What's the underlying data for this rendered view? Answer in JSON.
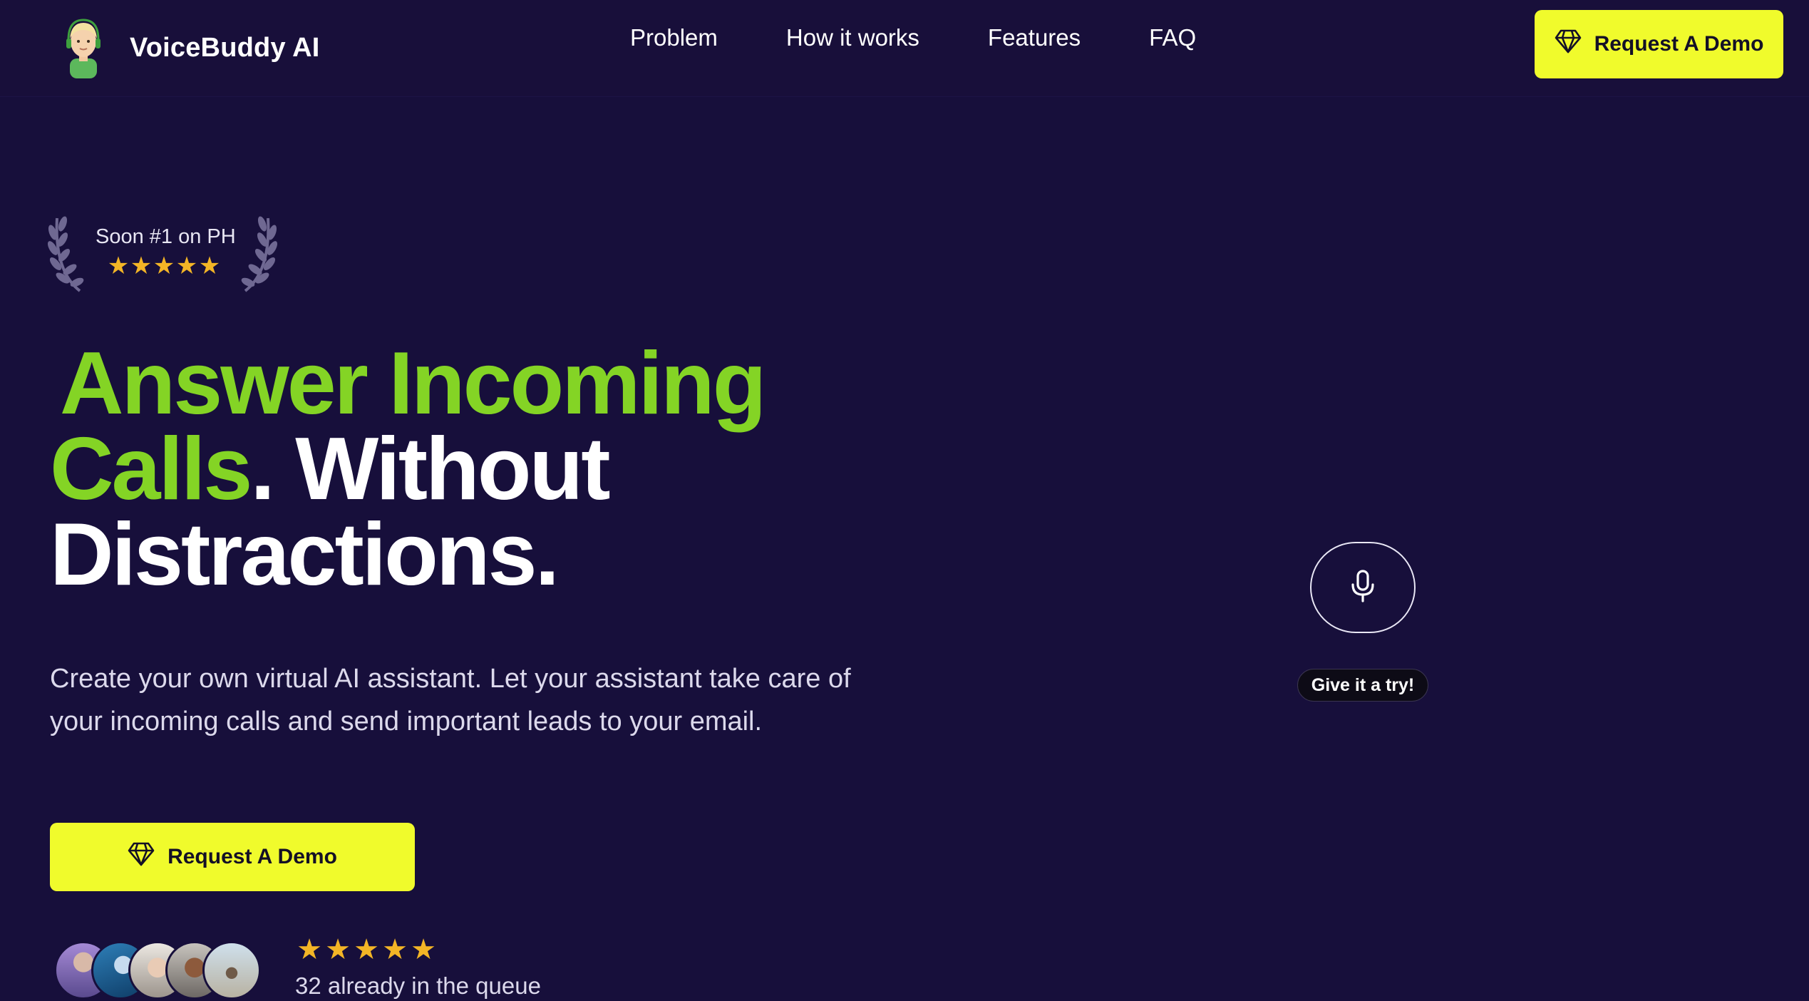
{
  "brand": {
    "name": "VoiceBuddy AI",
    "logo_icon": "person-with-headset-icon"
  },
  "nav": {
    "links": [
      "Problem",
      "How it works",
      "Features",
      "FAQ"
    ],
    "cta_label": "Request A Demo",
    "cta_icon": "diamond-icon"
  },
  "badge": {
    "text": "Soon #1 on PH",
    "stars": 5
  },
  "hero": {
    "headline_green_1": "Answer Incoming",
    "headline_green_2": "Calls",
    "headline_white_1": ". Without",
    "headline_white_2": "Distractions.",
    "subtext": "Create your own virtual AI assistant. Let your assistant take care of your incoming calls and send important leads to your email.",
    "cta_label": "Request A Demo"
  },
  "social_proof": {
    "stars": 5,
    "queue_text": "32 already in the queue"
  },
  "voice": {
    "mic_icon": "microphone-icon",
    "try_label": "Give it a try!"
  },
  "colors": {
    "background": "#170f3b",
    "accent_yellow": "#f0fb2c",
    "accent_green": "#84d425",
    "star": "#f3b526"
  }
}
